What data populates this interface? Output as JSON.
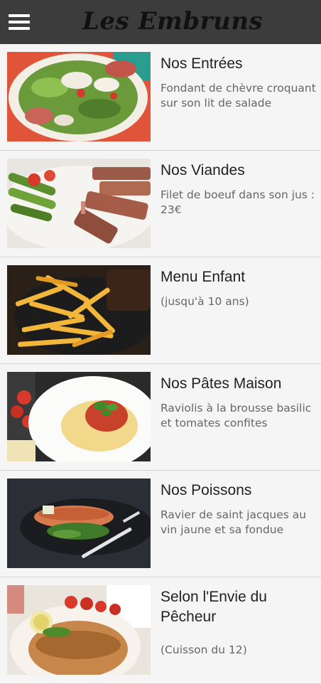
{
  "app": {
    "title": "Les Embruns",
    "menu_icon": "hamburger-menu-icon"
  },
  "categories": [
    {
      "title": "Nos Entrées",
      "description": "Fondant de chèvre croquant sur son lit de salade",
      "image": "salad-photo"
    },
    {
      "title": "Nos Viandes",
      "description": "Filet de boeuf dans son jus : 23€",
      "image": "steak-photo"
    },
    {
      "title": "Menu Enfant",
      "description": "(jusqu'à 10 ans)",
      "image": "fries-photo"
    },
    {
      "title": "Nos Pâtes Maison",
      "description": "Raviolis à la brousse basilic et tomates confites",
      "image": "pasta-photo"
    },
    {
      "title": "Nos Poissons",
      "description": "Ravier de saint jacques au vin jaune et sa fondue",
      "image": "salmon-photo"
    },
    {
      "title": "Selon l'Envie du Pêcheur",
      "description": "(Cuisson du 12)",
      "image": "fish-plate-photo"
    }
  ]
}
